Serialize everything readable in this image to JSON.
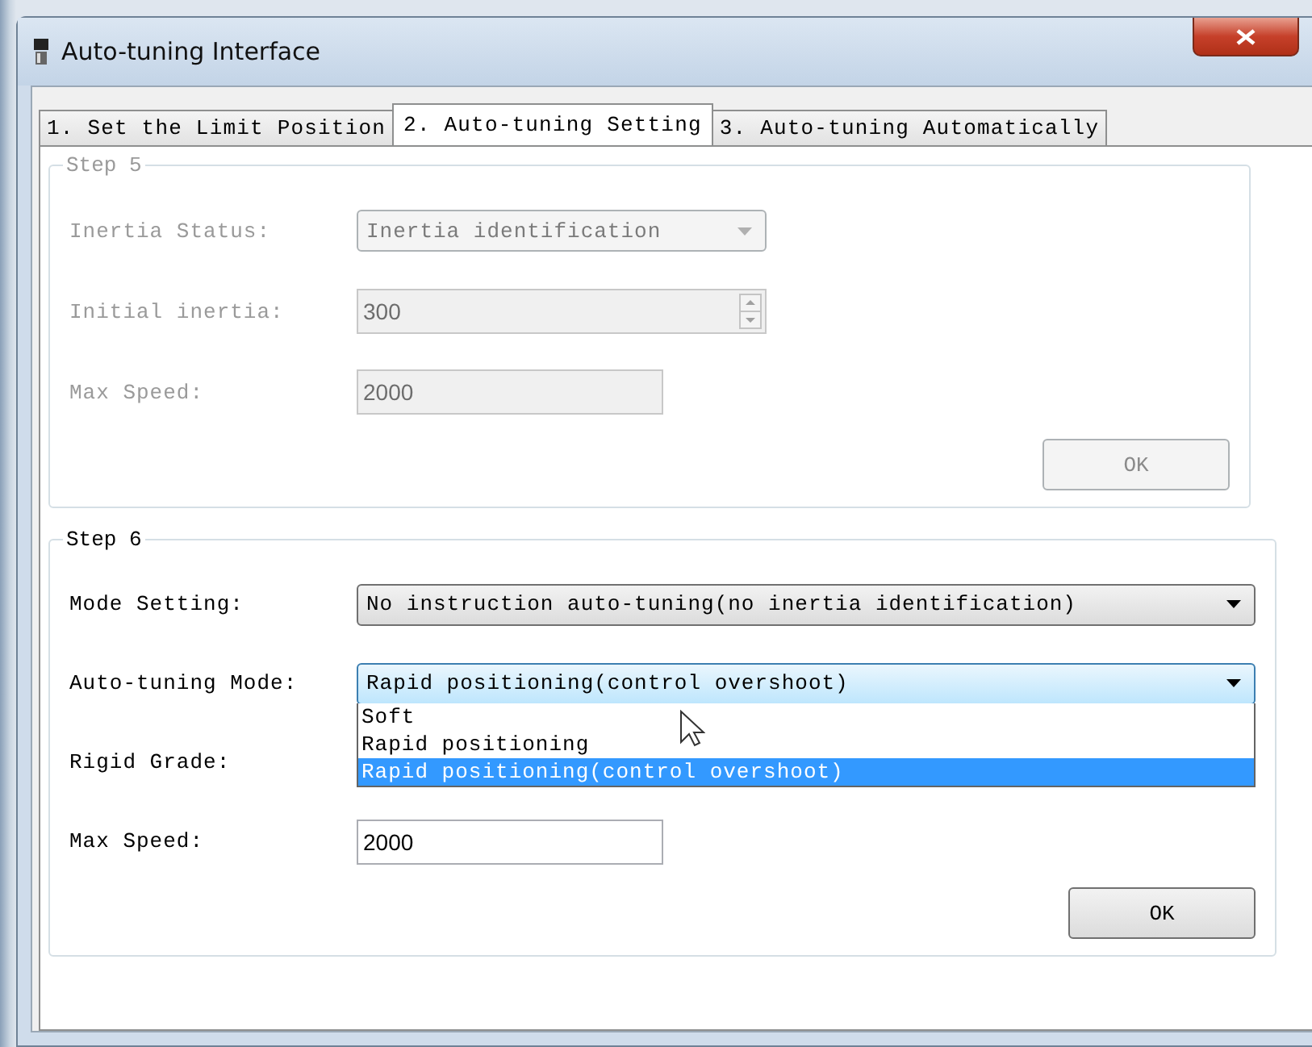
{
  "window": {
    "title": "Auto-tuning Interface"
  },
  "tabs": [
    {
      "label": "1. Set the Limit Position",
      "selected": false
    },
    {
      "label": "2. Auto-tuning Setting",
      "selected": true
    },
    {
      "label": "3. Auto-tuning Automatically",
      "selected": false
    }
  ],
  "groups": [
    {
      "title": "Step 5",
      "disabled": true,
      "fields": [
        {
          "kind": "combo",
          "label": "Inertia Status:",
          "value": "Inertia identification",
          "expanded": false
        },
        {
          "kind": "spin",
          "label": "Initial inertia:",
          "value": "300"
        },
        {
          "kind": "text",
          "label": "Max Speed:",
          "value": "2000"
        }
      ],
      "button": "OK"
    },
    {
      "title": "Step 6",
      "disabled": false,
      "fields": [
        {
          "kind": "longcombo",
          "label": "Mode Setting:",
          "value": "No instruction auto-tuning(no inertia identification)",
          "expanded": false
        },
        {
          "kind": "longcombo",
          "label": "Auto-tuning Mode:",
          "value": "Rapid positioning(control overshoot)",
          "expanded": true,
          "options": [
            {
              "label": "Soft",
              "selected": false
            },
            {
              "label": "Rapid positioning",
              "selected": false
            },
            {
              "label": "Rapid positioning(control overshoot)",
              "selected": true
            }
          ]
        },
        {
          "kind": "covered",
          "label": "Rigid Grade:"
        },
        {
          "kind": "text",
          "label": "Max Speed:",
          "value": "2000"
        }
      ],
      "button": "OK"
    }
  ]
}
